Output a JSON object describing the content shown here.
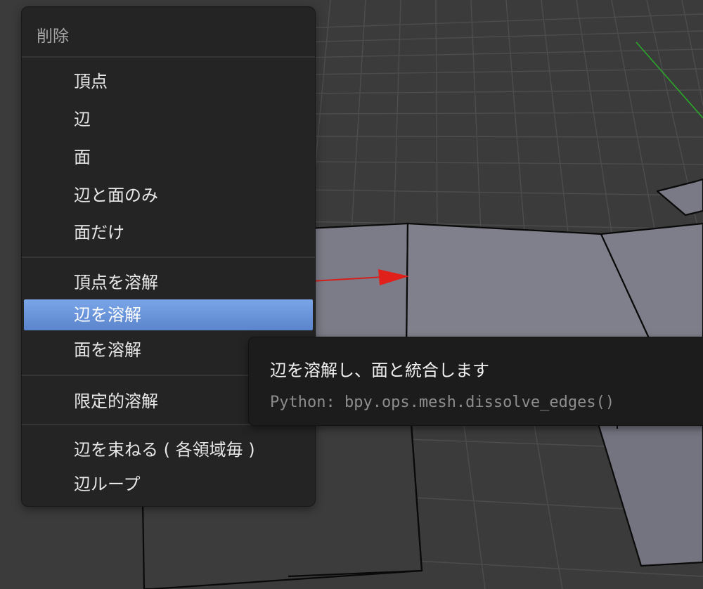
{
  "menu": {
    "title": "削除",
    "items": [
      {
        "label": "頂点"
      },
      {
        "label": "辺"
      },
      {
        "label": "面"
      },
      {
        "label": "辺と面のみ"
      },
      {
        "label": "面だけ"
      },
      {
        "label": "頂点を溶解"
      },
      {
        "label": "辺を溶解",
        "active": true
      },
      {
        "label": "面を溶解"
      },
      {
        "label": "限定的溶解"
      },
      {
        "label": "辺を束ねる ( 各領域毎 )"
      },
      {
        "label": "辺ループ"
      }
    ]
  },
  "tooltip": {
    "description": "辺を溶解し、面と統合します",
    "python": "Python: bpy.ops.mesh.dissolve_edges()"
  },
  "colors": {
    "viewport_bg": "#3b3b3b",
    "menu_bg": "#242424",
    "highlight": "#6a94da",
    "mesh_face": "#7c7c88",
    "x_axis": "#e0201a",
    "y_axis": "#2aa82a",
    "z_axis": "#2c2c80"
  }
}
